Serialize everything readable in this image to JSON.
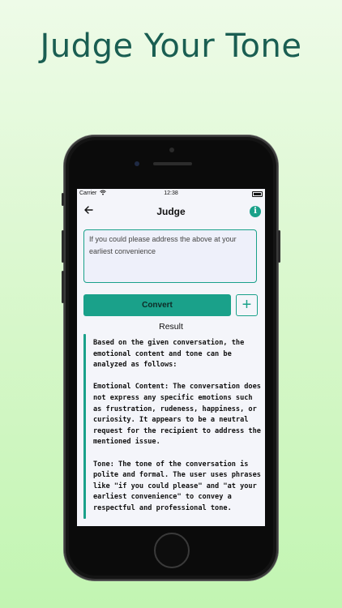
{
  "headline": "Judge Your Tone",
  "status_bar": {
    "carrier": "Carrier",
    "time": "12:38"
  },
  "nav": {
    "title": "Judge"
  },
  "input": {
    "text": "If you could please address the above at your earliest convenience"
  },
  "buttons": {
    "convert_label": "Convert",
    "add_label": "+"
  },
  "result": {
    "label": "Result",
    "paragraphs": [
      "Based on the given conversation, the emotional content and tone can be analyzed as follows:",
      "Emotional Content: The conversation does not express any specific emotions such as frustration, rudeness, happiness, or curiosity. It appears to be a neutral request for the recipient to address the mentioned issue.",
      "Tone: The tone of the conversation is polite and formal. The user uses phrases like \"if you could please\" and \"at your earliest convenience\" to convey a respectful and professional tone."
    ]
  },
  "colors": {
    "accent": "#1aa18a",
    "headline": "#1a5e52",
    "background": "#d6f7c9"
  },
  "icons": {
    "back": "arrow-left-icon",
    "info": "info-icon",
    "wifi": "wifi-icon",
    "battery": "battery-icon"
  }
}
